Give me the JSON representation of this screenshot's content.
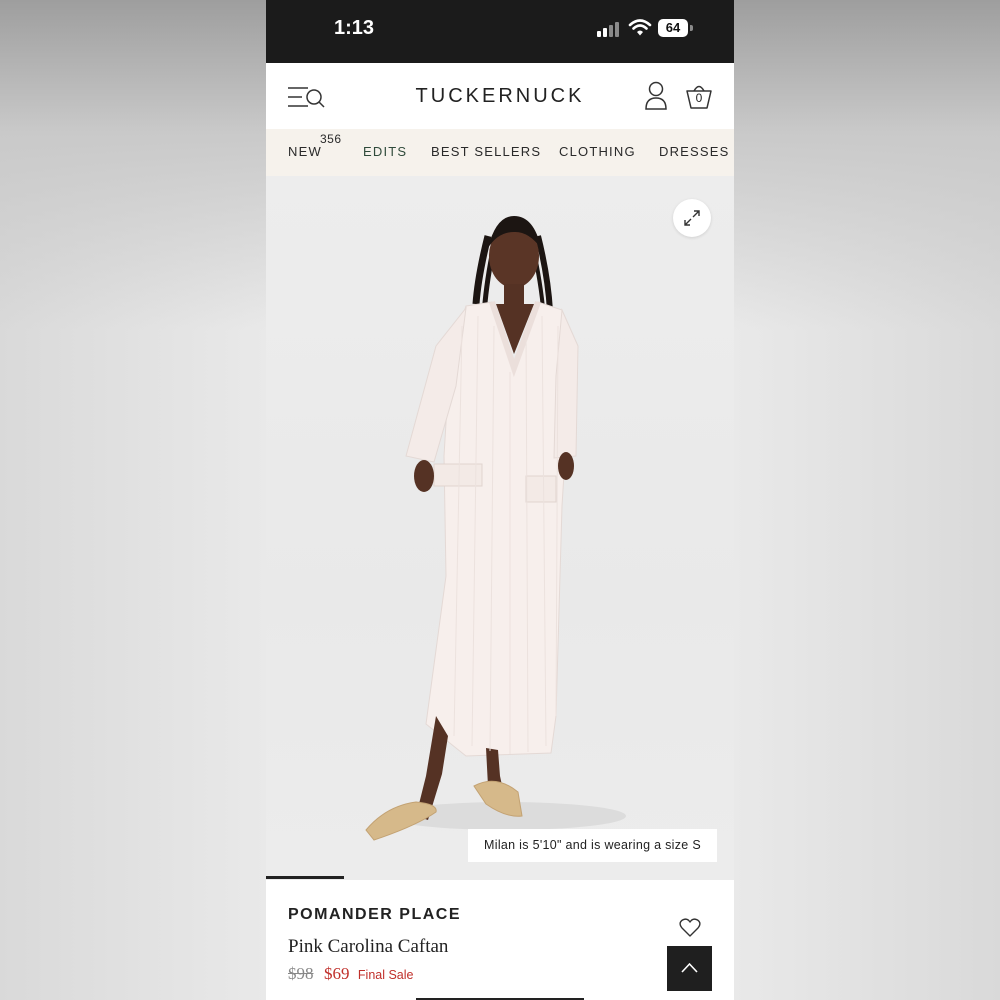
{
  "status_bar": {
    "time": "1:13",
    "battery": "64"
  },
  "header": {
    "brand": "TUCKERNUCK",
    "bag_count": "0"
  },
  "nav": {
    "items": [
      "NEW",
      "EDITS",
      "BEST SELLERS",
      "CLOTHING",
      "DRESSES"
    ],
    "new_badge": "356"
  },
  "gallery": {
    "caption": "Milan is 5'10\" and is wearing a size S"
  },
  "product": {
    "brand": "POMANDER PLACE",
    "name": "Pink Carolina Caftan",
    "original_price": "$98",
    "sale_price": "$69",
    "sale_label": "Final Sale"
  },
  "colors": {
    "accent_sale": "#c0302b",
    "nav_background": "#f6f2ec",
    "edits_text": "#2f4a3a"
  }
}
